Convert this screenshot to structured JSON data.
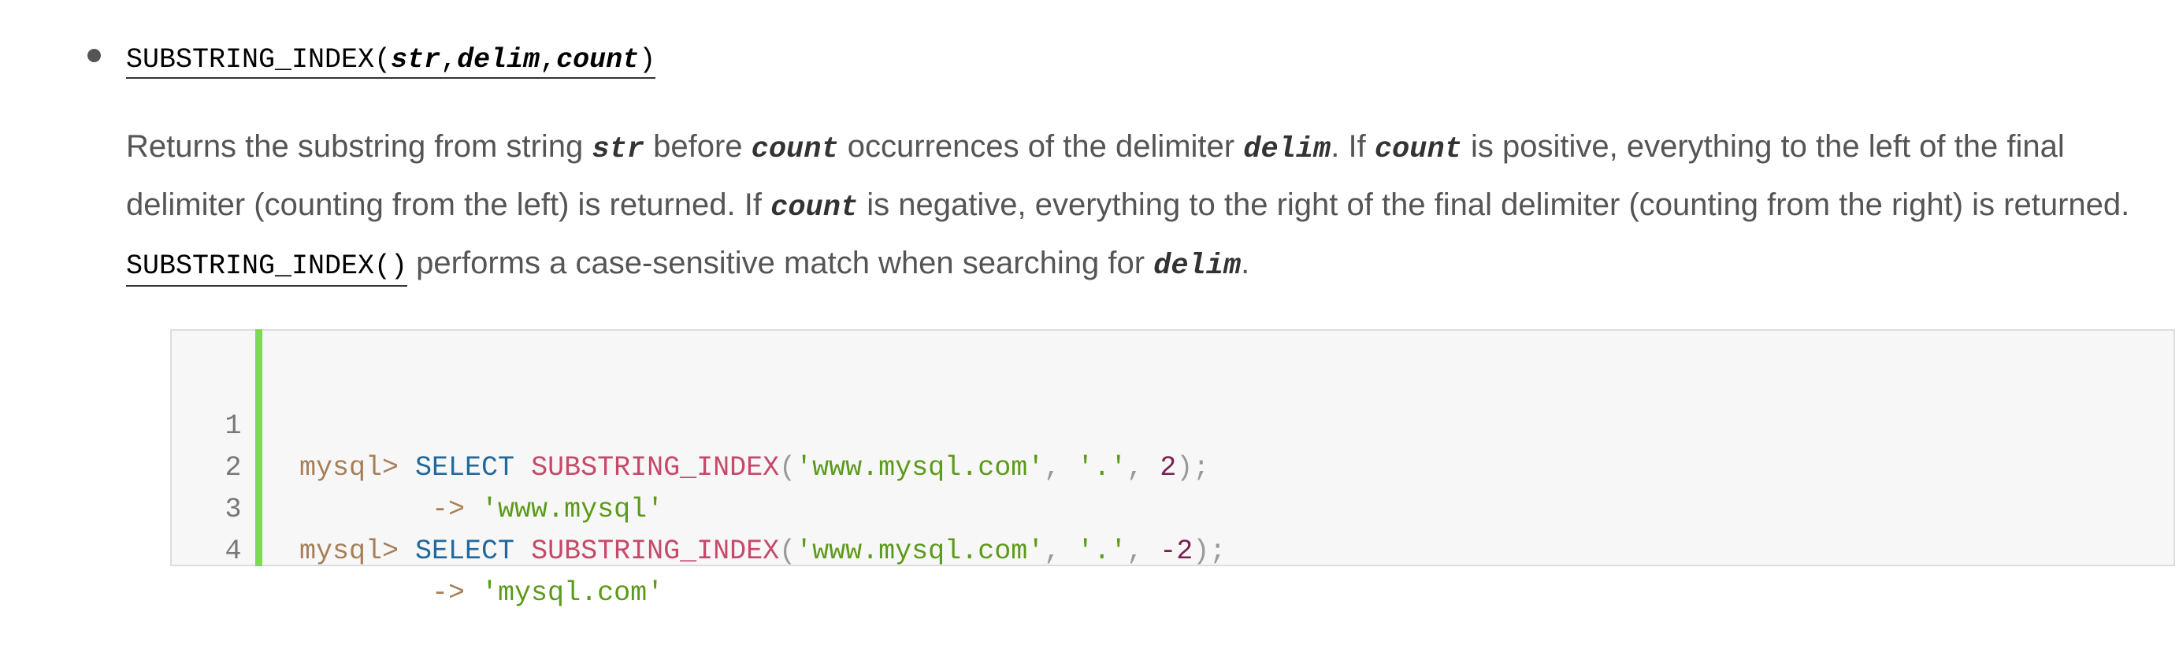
{
  "entry": {
    "function_name": "SUBSTRING_INDEX",
    "open_paren": "(",
    "arg1": "str",
    "comma1": ",",
    "arg2": "delim",
    "comma2": ",",
    "arg3": "count",
    "close_paren": ")"
  },
  "description": {
    "p1": "Returns the substring from string ",
    "c1": "str",
    "p2": " before ",
    "c2": "count",
    "p3": " occurrences of the delimiter ",
    "c3": "delim",
    "p4": ". If ",
    "c4": "count",
    "p5": " is positive, everything to the left of the final delimiter (counting from the left) is returned. If ",
    "c5": "count",
    "p6": " is negative, everything to the right of the final delimiter (counting from the right) is returned. ",
    "fn": "SUBSTRING_INDEX()",
    "p7": " performs a case-sensitive match when searching for ",
    "c6": "delim",
    "p8": "."
  },
  "code": {
    "lines": [
      {
        "number": "1",
        "prompt": "mysql> ",
        "keyword": "SELECT",
        "func": "SUBSTRING_INDEX",
        "open": "(",
        "str1": "'www.mysql.com'",
        "sep1": ", ",
        "str2": "'.'",
        "sep2": ", ",
        "num": "2",
        "close": ");"
      },
      {
        "number": "2",
        "indent": "        ",
        "arrow": "-> ",
        "result": "'www.mysql'"
      },
      {
        "number": "3",
        "prompt": "mysql> ",
        "keyword": "SELECT",
        "func": "SUBSTRING_INDEX",
        "open": "(",
        "str1": "'www.mysql.com'",
        "sep1": ", ",
        "str2": "'.'",
        "sep2": ", ",
        "num": "-2",
        "close": ");"
      },
      {
        "number": "4",
        "indent": "        ",
        "arrow": "-> ",
        "result": "'mysql.com'"
      }
    ]
  },
  "colors": {
    "accent_bar": "#7ed957",
    "keyword": "#21689e",
    "function": "#c7496a",
    "string": "#5c9a1a",
    "number": "#7a1f4f",
    "prompt": "#a67f59"
  }
}
